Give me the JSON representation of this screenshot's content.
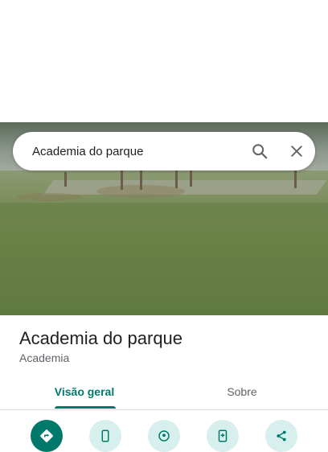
{
  "search": {
    "query": "Academia do parque",
    "search_icon": "search-icon",
    "close_icon": "close-icon"
  },
  "place": {
    "name": "Academia do parque",
    "category": "Academia",
    "photo": "park-gym-photo"
  },
  "tabs": [
    {
      "label": "Visão geral",
      "selected": true
    },
    {
      "label": "Sobre",
      "selected": false
    }
  ],
  "actions": [
    {
      "icon": "directions-icon"
    },
    {
      "icon": "phone-icon"
    },
    {
      "icon": "location-icon"
    },
    {
      "icon": "save-to-phone-icon"
    },
    {
      "icon": "share-icon"
    }
  ],
  "colors": {
    "accent": "#00796b",
    "accent_light": "#d7f0ee",
    "text_primary": "#202124",
    "text_secondary": "#5f6368"
  }
}
